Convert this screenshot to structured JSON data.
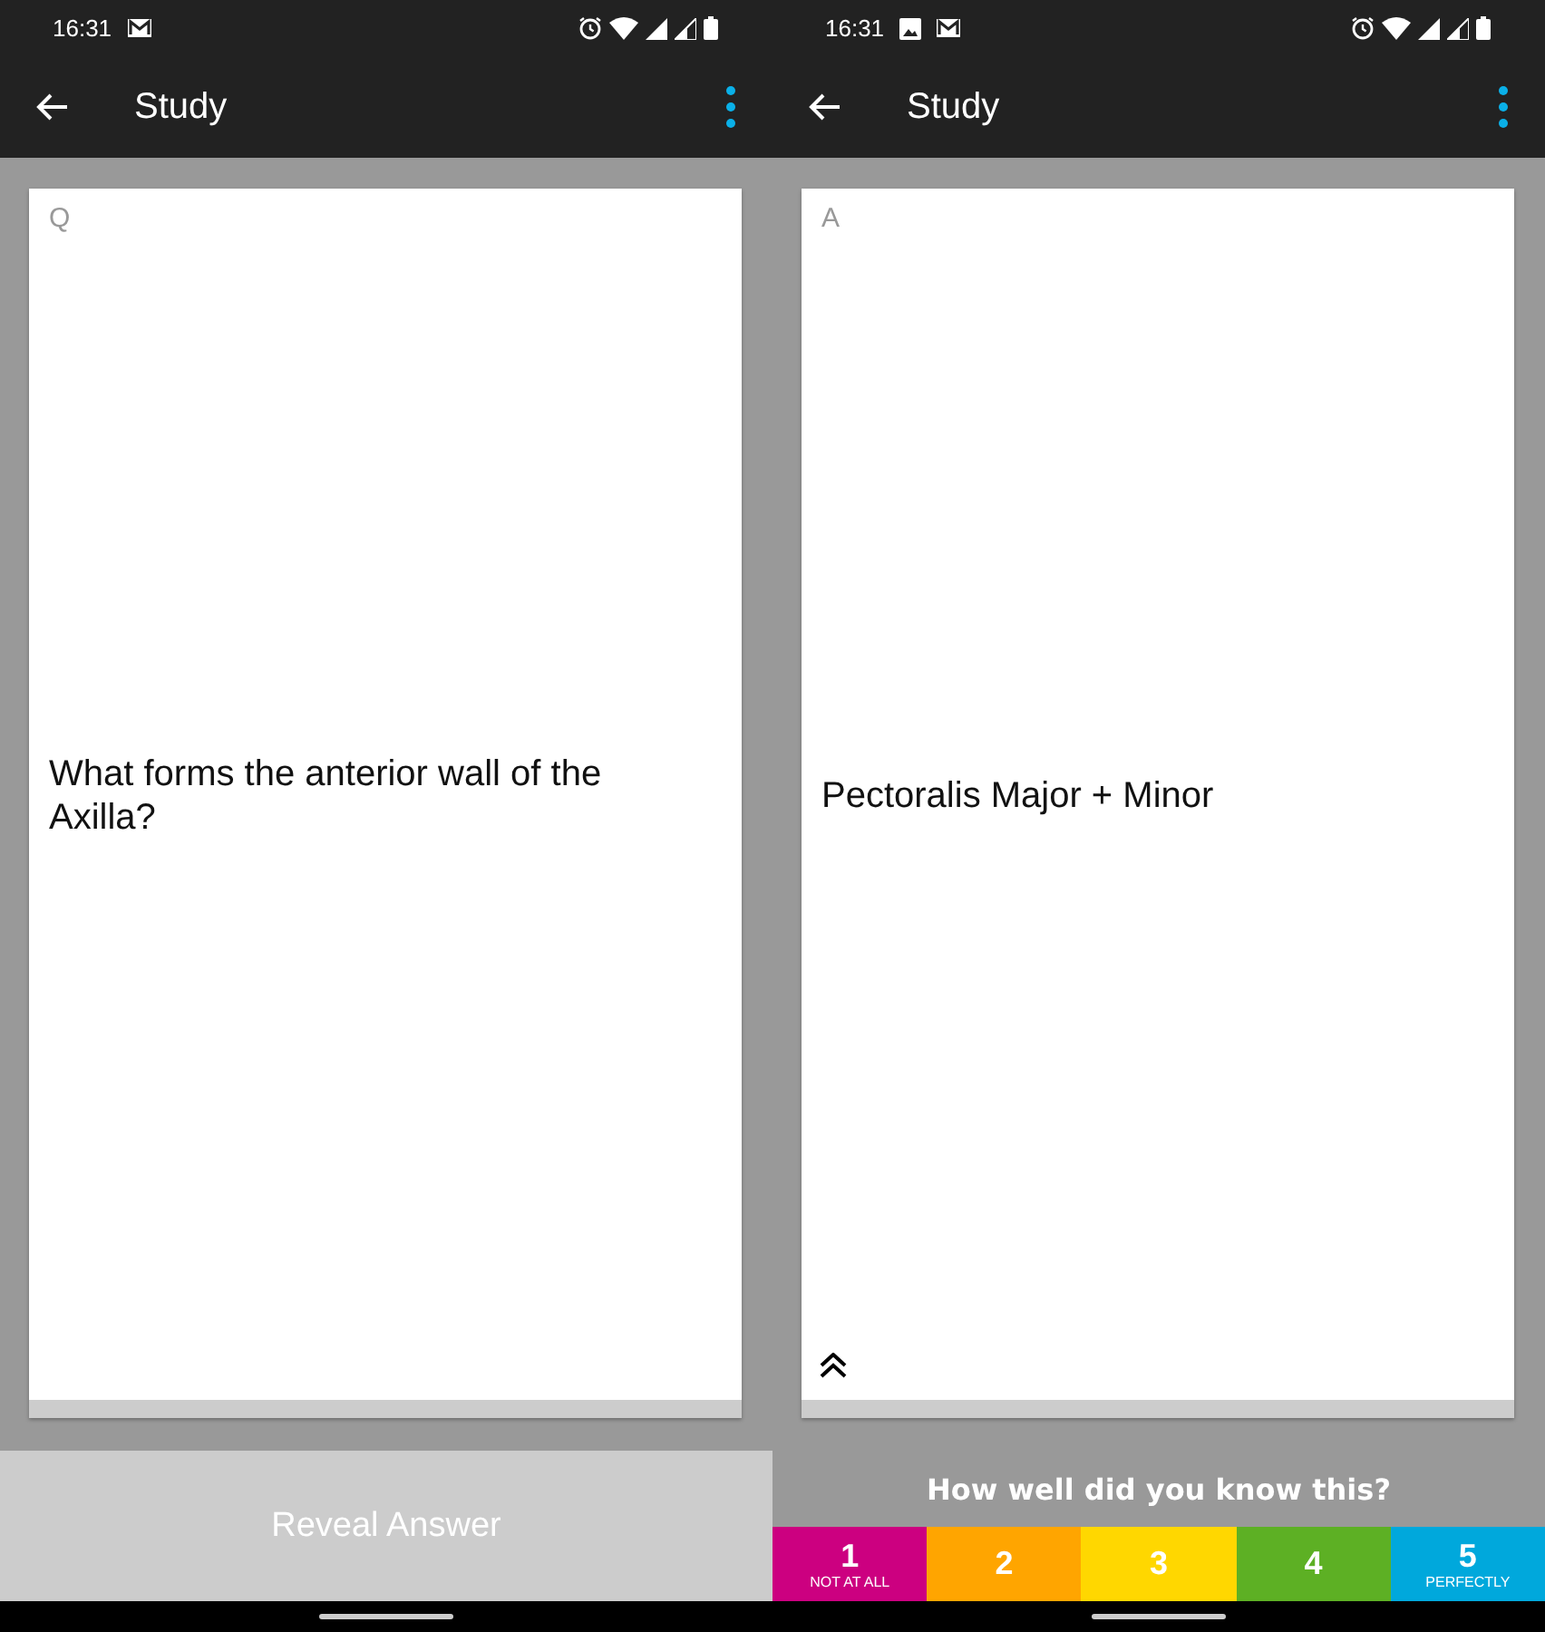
{
  "screens": [
    {
      "status_bar": {
        "time": "16:31",
        "notifications": [
          {
            "kind": "mail"
          }
        ]
      },
      "app_bar": {
        "title": "Study"
      },
      "card": {
        "side_label": "Q",
        "text": "What forms the anterior wall of the Axilla?",
        "collapse_control": false
      },
      "footer": {
        "kind": "reveal",
        "button": "Reveal Answer"
      }
    },
    {
      "status_bar": {
        "time": "16:31",
        "notifications": [
          {
            "kind": "image"
          },
          {
            "kind": "mail"
          }
        ]
      },
      "app_bar": {
        "title": "Study"
      },
      "card": {
        "side_label": "A",
        "text": "Pectoralis Major + Minor",
        "collapse_control": true
      },
      "footer": {
        "kind": "rating",
        "prompt": "How well did you know this?",
        "ratings": [
          {
            "number": "1",
            "caption": "NOT AT ALL",
            "color": "#cc0080"
          },
          {
            "number": "2",
            "color": "#ffa500"
          },
          {
            "number": "3",
            "color": "#ffd700"
          },
          {
            "number": "4",
            "color": "#5db024"
          },
          {
            "number": "5",
            "caption": "PERFECTLY",
            "color": "#00a8dc"
          }
        ]
      }
    }
  ]
}
